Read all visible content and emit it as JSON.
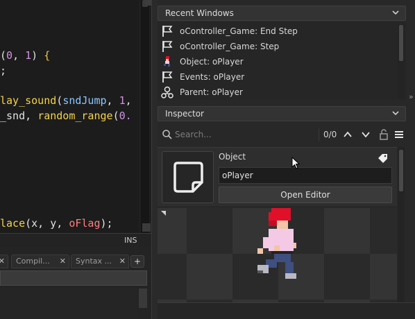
{
  "editor": {
    "code_lines": [
      {
        "parts": [
          [
            "(",
            ""
          ],
          [
            "0",
            "num"
          ],
          [
            ", ",
            ""
          ],
          [
            "1",
            "num"
          ],
          [
            ")",
            ""
          ],
          [
            " {",
            "br"
          ]
        ]
      },
      {
        "parts": [
          [
            ";",
            ""
          ]
        ]
      },
      {
        "parts": [
          [
            "lay_sound",
            "fn"
          ],
          [
            "(",
            ""
          ],
          [
            "sndJump",
            "res"
          ],
          [
            ", ",
            ""
          ],
          [
            "1",
            "num"
          ],
          [
            ",",
            ""
          ]
        ]
      },
      {
        "parts": [
          [
            "_snd, ",
            ""
          ],
          [
            "random_range",
            "fn"
          ],
          [
            "(",
            ""
          ],
          [
            "0.",
            "num"
          ]
        ]
      },
      {
        "parts": [
          [
            "lace",
            "fn"
          ],
          [
            "(x, y, ",
            ""
          ],
          [
            "oFlag",
            "obj"
          ],
          [
            ");",
            ""
          ]
        ]
      }
    ],
    "status_mode": "INS",
    "bottom_tabs": [
      "Compil...",
      "Syntax ..."
    ],
    "tab_plus": "+",
    "tab_close": "✕"
  },
  "recent_windows": {
    "title": "Recent Windows",
    "items": [
      {
        "label": "oController_Game: End Step",
        "icon": "flag-icon"
      },
      {
        "label": "oController_Game: Step",
        "icon": "flag-icon"
      },
      {
        "label": "Object: oPlayer",
        "icon": "object-icon"
      },
      {
        "label": "Events: oPlayer",
        "icon": "flag-icon"
      },
      {
        "label": "Parent: oPlayer",
        "icon": "parent-icon"
      }
    ]
  },
  "inspector": {
    "title": "Inspector",
    "search_placeholder": "Search...",
    "match_count": "0/0",
    "object_kind": "Object",
    "object_name": "oPlayer",
    "open_editor_label": "Open Editor"
  },
  "colors": {
    "accent_red": "#e0102a",
    "shirt": "#f4c9e6",
    "pants": "#3e4f80"
  }
}
